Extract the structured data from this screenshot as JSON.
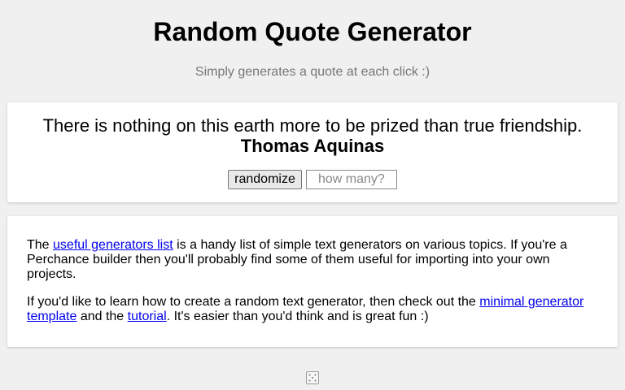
{
  "header": {
    "title": "Random Quote Generator",
    "subtitle": "Simply generates a quote at each click :)"
  },
  "quote": {
    "text": "There is nothing on this earth more to be prized than true friendship.",
    "author": "Thomas Aquinas"
  },
  "controls": {
    "randomize_label": "randomize",
    "howmany_placeholder": "how many?",
    "howmany_value": ""
  },
  "info": {
    "p1_before": "The ",
    "p1_link": "useful generators list",
    "p1_after": " is a handy list of simple text generators on various topics. If you're a Perchance builder then you'll probably find some of them useful for importing into your own projects.",
    "p2_before": "If you'd like to learn how to create a random text generator, then check out the ",
    "p2_link1": "minimal generator template",
    "p2_middle": " and the ",
    "p2_link2": "tutorial",
    "p2_after": ". It's easier than you'd think and is great fun :)"
  },
  "footer": {
    "icon": "dice-icon"
  },
  "colors": {
    "background": "#f0f0f0",
    "card": "#ffffff",
    "link": "#0000ee",
    "subtitle": "#777777"
  }
}
